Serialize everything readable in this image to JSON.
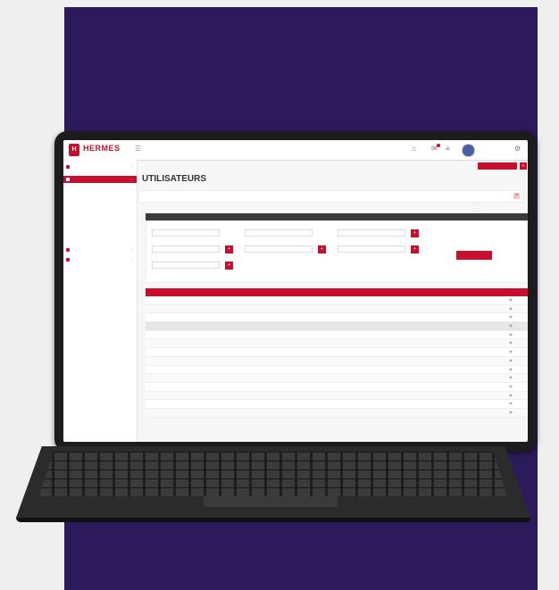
{
  "app": {
    "brand": "HERMES",
    "brand_sub": "",
    "user_name": ""
  },
  "topbar_icons": [
    "user-icon",
    "notification-icon",
    "mail-icon",
    "settings-icon"
  ],
  "sidebar": {
    "items": [
      {
        "label": "",
        "kind": "main"
      },
      {
        "label": "",
        "kind": "active"
      },
      {
        "label": "",
        "kind": "sub"
      },
      {
        "label": "",
        "kind": "sub-red"
      },
      {
        "label": "",
        "kind": "sub"
      },
      {
        "label": "",
        "kind": "sub"
      },
      {
        "label": "",
        "kind": "sub"
      },
      {
        "label": "",
        "kind": "sub"
      },
      {
        "label": "",
        "kind": "sub"
      },
      {
        "label": "",
        "kind": "sub"
      },
      {
        "label": "",
        "kind": "main"
      },
      {
        "label": "",
        "kind": "main"
      }
    ]
  },
  "breadcrumb": {
    "text": "",
    "action_button": ""
  },
  "page": {
    "title": "UTILISATEURS",
    "tab_label": "",
    "add_link": ""
  },
  "filters": {
    "header": "",
    "fields": [
      {
        "label": "",
        "placeholder": ""
      },
      {
        "label": "",
        "placeholder": ""
      },
      {
        "label": "",
        "placeholder": ""
      },
      {
        "label": "",
        "placeholder": ""
      },
      {
        "label": "",
        "placeholder": ""
      },
      {
        "label": "",
        "placeholder": ""
      },
      {
        "label": "",
        "placeholder": ""
      }
    ],
    "submit": "",
    "reset": ""
  },
  "table": {
    "columns": [
      "",
      "",
      "",
      "",
      "",
      "",
      "",
      ""
    ],
    "row_count": 14,
    "highlighted_row": 3
  },
  "colors": {
    "accent": "#c8102e",
    "panel": "#2c1b5a",
    "device": "#1c1c1c"
  }
}
